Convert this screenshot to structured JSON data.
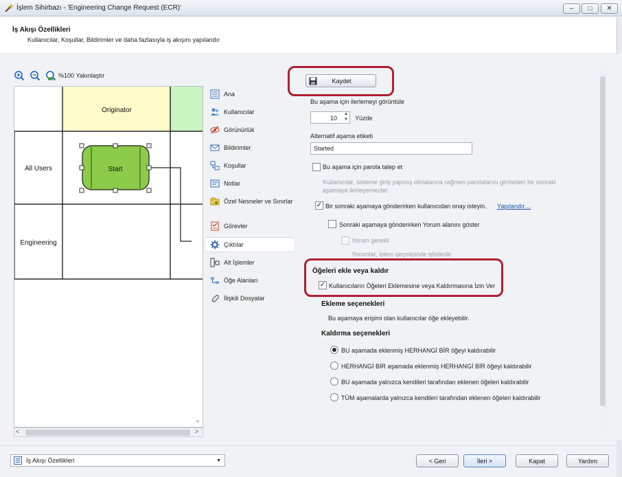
{
  "window": {
    "title": "İşlem Sihirbazı - 'Engineering Change Request (ECR)'",
    "controls": {
      "minimize": "–",
      "maximize": "□",
      "close": "✕"
    }
  },
  "header": {
    "title": "İş Akışı Özellikleri",
    "subtitle": "Kullanıcılar, Koşullar, Bildirimler ve daha fazlasıyla iş akışını yapılandır"
  },
  "diagram": {
    "zoom_label": "%100 Yakınlaştır",
    "columns": [
      "Originator"
    ],
    "rows": [
      "All Users",
      "Engineering"
    ],
    "start_node": "Start",
    "scroll": {
      "left": "<",
      "right": ">",
      "down": "⌄"
    }
  },
  "nav": {
    "items": [
      {
        "label": "Ana",
        "icon": "list-icon",
        "active": false
      },
      {
        "label": "Kullanıcılar",
        "icon": "users-icon",
        "active": false
      },
      {
        "label": "Görünürlük",
        "icon": "visibility-icon",
        "active": false
      },
      {
        "label": "Bildirimler",
        "icon": "mail-icon",
        "active": false
      },
      {
        "label": "Koşullar",
        "icon": "conditions-icon",
        "active": false
      },
      {
        "label": "Notlar",
        "icon": "notes-icon",
        "active": false
      },
      {
        "label": "Özel Nesneler ve Sınırlar",
        "icon": "objects-icon",
        "active": false
      },
      {
        "label": "Görevler",
        "icon": "tasks-icon",
        "active": false
      },
      {
        "label": "Çıktılar",
        "icon": "gear-icon",
        "active": true
      },
      {
        "label": "Alt İşlemler",
        "icon": "subprocess-icon",
        "active": false
      },
      {
        "label": "Öğe Alanları",
        "icon": "fields-icon",
        "active": false
      },
      {
        "label": "İlişkili Dosyalar",
        "icon": "paperclip-icon",
        "active": false
      }
    ]
  },
  "form": {
    "save_label": "Kaydet",
    "progress_label": "Bu aşama için ilerlemeyi görüntüle",
    "progress_value": "10",
    "progress_unit": "Yüzde",
    "stepper_up": "▲",
    "stepper_down": "▼",
    "alt_label": "Alternatif aşama etiketi",
    "alt_value": "Started",
    "password_label": "Bu aşama için parola talep et",
    "password_desc": "Kullanıcılar, sisteme giriş yapmış olmalarına rağmen parolalarını girmeden bir sonraki aşamaya ilerleyemezler.",
    "confirm_label": "Bir sonraki aşamaya gönderirken kullanıcıdan onay isteyin.",
    "configure_link": "Yapılandır…",
    "comment_label": "Sonraki aşamaya gönderirken Yorum alanını göster",
    "comment_required": "Yorum gerekli",
    "comment_history": "Yorumlar, işlem geçmişinde gösterilir",
    "items_section": "Öğeleri ekle veya kaldır",
    "allow_items_label": "Kullanıcıların Öğeleri Eklemesine veya Kaldırmasına İzin Ver",
    "check_mark": "✓",
    "add_section": "Ekleme seçenekleri",
    "add_desc": "Bu aşamaya erişimi olan kullanıcılar öğe ekleyebilir.",
    "remove_section": "Kaldırma seçenekleri",
    "remove_options": [
      "BU aşamada eklenmiş HERHANGİ BİR öğeyi kaldırabilir",
      "HERHANGİ BİR aşamada eklenmiş HERHANGİ BİR öğeyi kaldırabilir",
      "BU aşamada yalnızca kendileri tarafından eklenen öğeleri kaldırabilir",
      "TÜM aşamalarda yalnızca kendileri tarafından eklenen öğeleri kaldırabilir"
    ],
    "remove_selected": 0
  },
  "footer": {
    "select_value": "İş Akışı Özellikleri",
    "select_arrow": "▼",
    "back": "< Geri",
    "next": "İleri >",
    "close": "Kapat",
    "help": "Yardım"
  },
  "colors": {
    "highlight": "#b01e32",
    "lane_header_yellow": "#fdfbc9",
    "lane_header_green": "#c8f5c0",
    "start_fill": "#8ccc4a"
  }
}
